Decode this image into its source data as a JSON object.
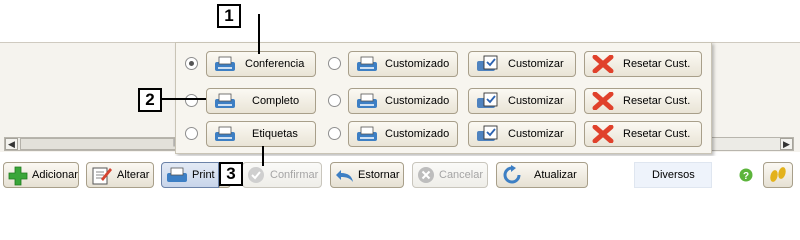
{
  "popup": {
    "rows": [
      {
        "option": "Conferencia",
        "checked": true
      },
      {
        "option": "Completo",
        "checked": false
      },
      {
        "option": "Etiquetas",
        "checked": false
      }
    ],
    "col2_label": "Customizado",
    "col3_label": "Customizar",
    "col4_label": "Resetar Cust."
  },
  "toolbar": {
    "adicionar": "Adicionar",
    "alterar": "Alterar",
    "print": "Print",
    "confirmar": "Confirmar",
    "estornar": "Estornar",
    "cancelar": "Cancelar",
    "atualizar": "Atualizar",
    "diversos": "Diversos"
  },
  "callouts": {
    "one": "1",
    "two": "2",
    "three": "3"
  },
  "colors": {
    "accent_green": "#3aa63a",
    "reset_red": "#e0412b",
    "printer_blue": "#3d7fc4"
  }
}
